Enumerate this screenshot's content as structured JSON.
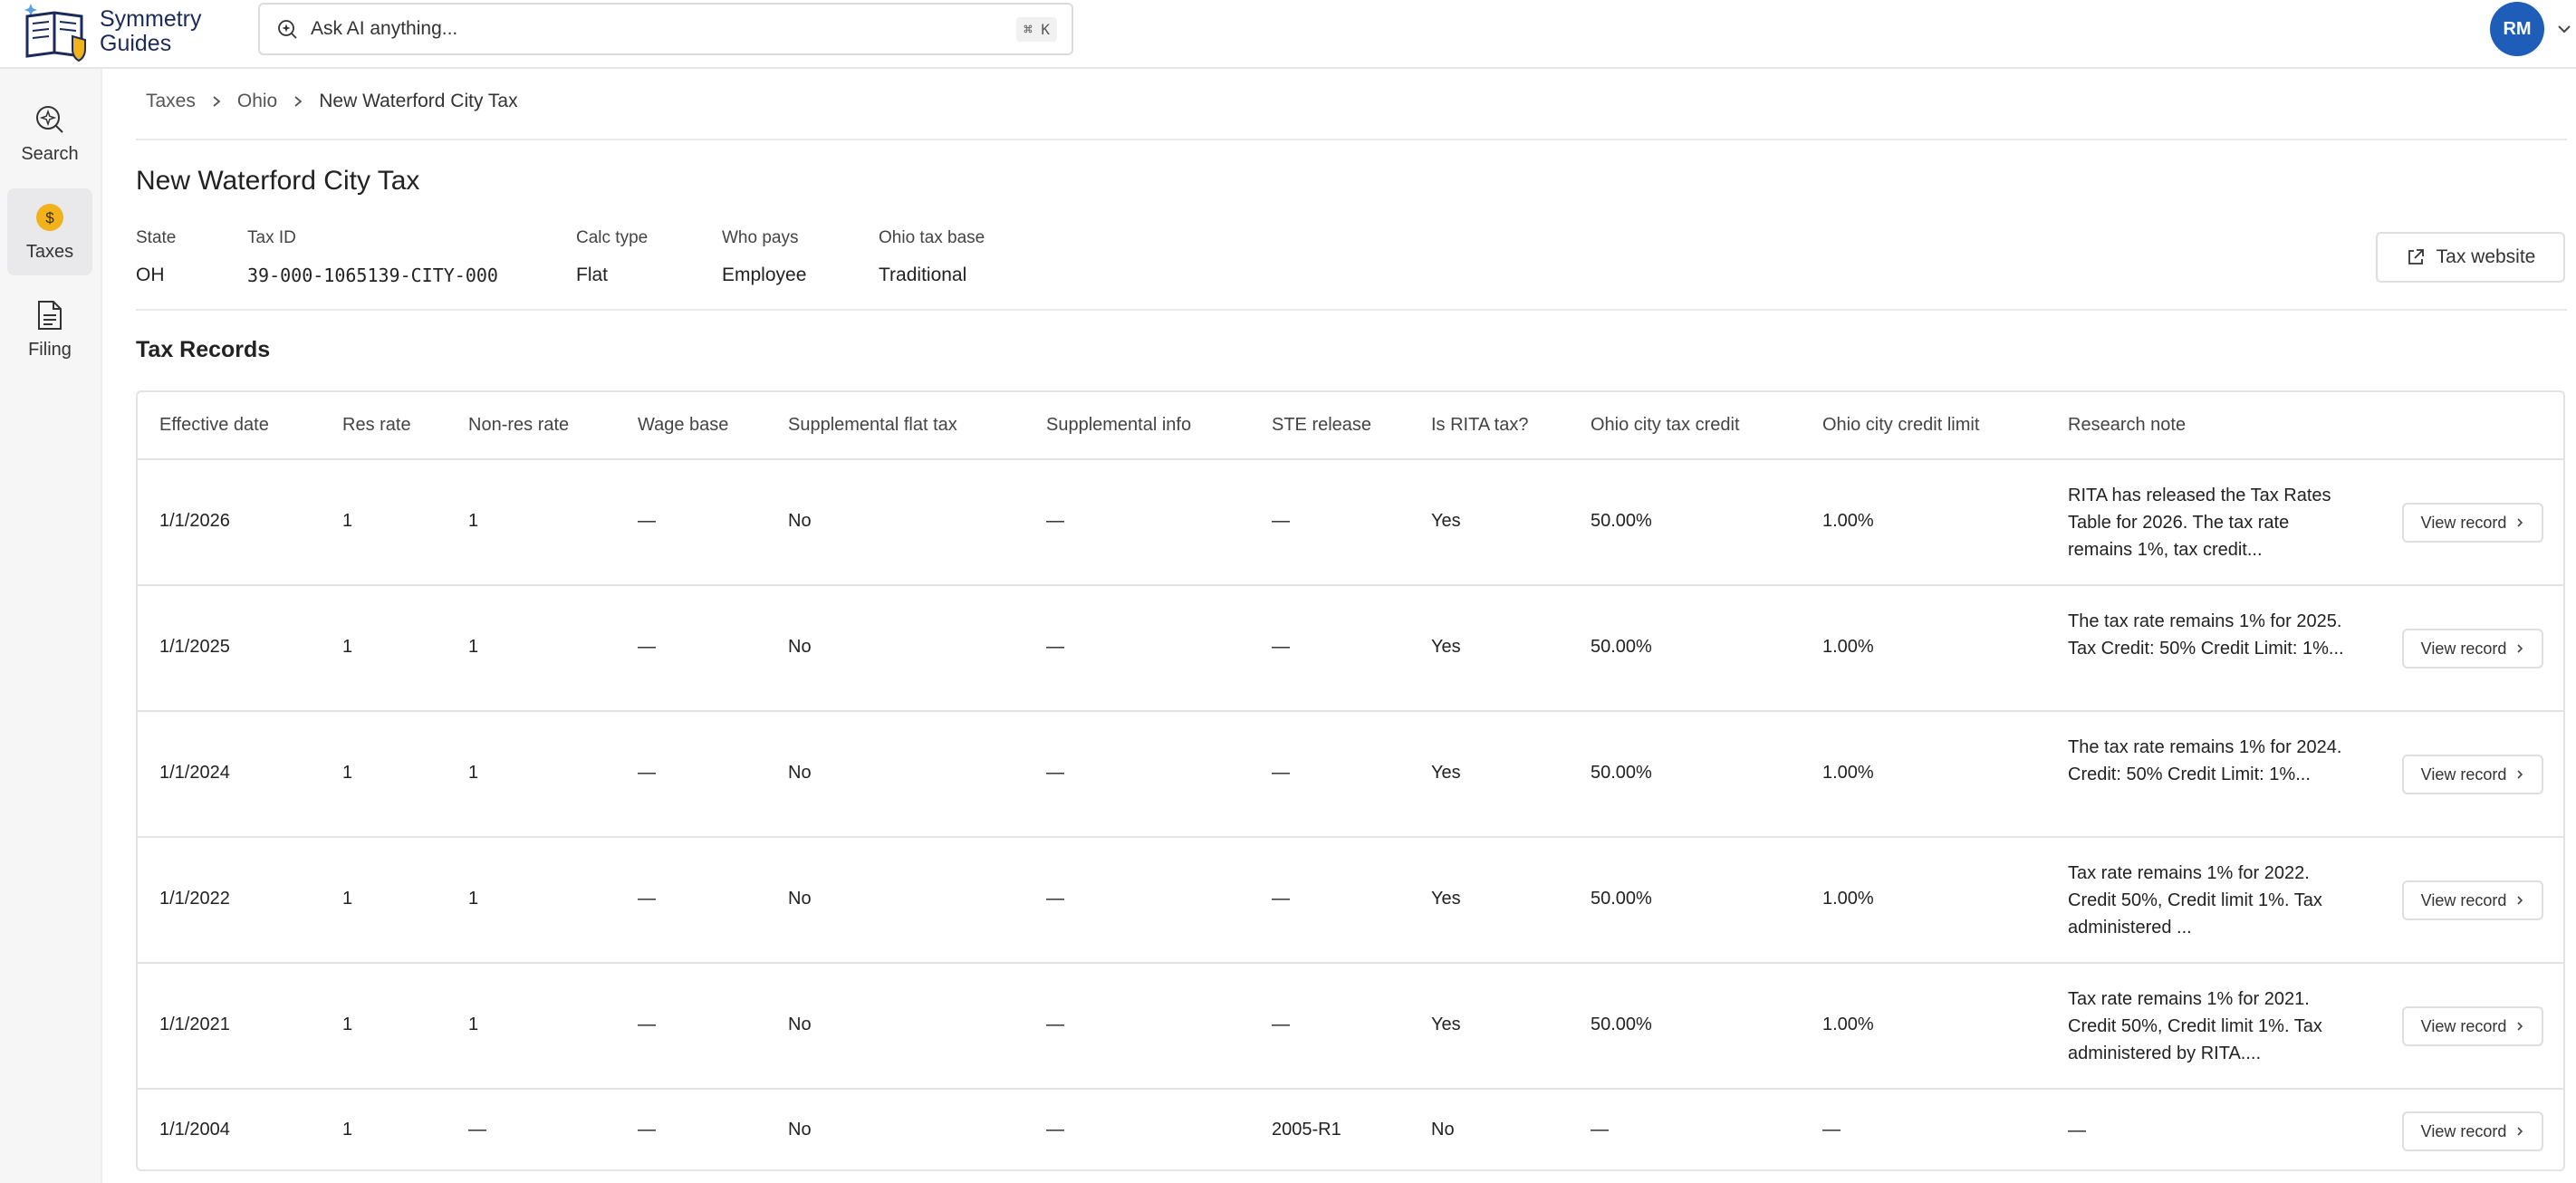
{
  "app": {
    "brand_line1": "Symmetry",
    "brand_line2": "Guides"
  },
  "search": {
    "placeholder": "Ask AI anything...",
    "shortcut": "⌘ K"
  },
  "user": {
    "initials": "RM"
  },
  "sidebar": {
    "items": [
      {
        "label": "Search",
        "icon": "search-sparkle-icon"
      },
      {
        "label": "Taxes",
        "icon": "dollar-coin-icon",
        "active": true
      },
      {
        "label": "Filing",
        "icon": "document-icon"
      }
    ]
  },
  "breadcrumb": [
    "Taxes",
    "Ohio",
    "New Waterford City Tax"
  ],
  "page": {
    "title": "New Waterford City Tax",
    "tax_website_label": "Tax website"
  },
  "meta": [
    {
      "label": "State",
      "value": "OH"
    },
    {
      "label": "Tax ID",
      "value": "39-000-1065139-CITY-000"
    },
    {
      "label": "Calc type",
      "value": "Flat"
    },
    {
      "label": "Who pays",
      "value": "Employee"
    },
    {
      "label": "Ohio tax base",
      "value": "Traditional"
    }
  ],
  "records": {
    "title": "Tax Records",
    "columns": [
      "Effective date",
      "Res rate",
      "Non-res rate",
      "Wage base",
      "Supplemental flat tax",
      "Supplemental info",
      "STE release",
      "Is RITA tax?",
      "Ohio city tax credit",
      "Ohio city credit limit",
      "Research note"
    ],
    "view_label": "View record",
    "rows": [
      {
        "date": "1/1/2026",
        "res": "1",
        "nonres": "1",
        "wage": "—",
        "supp_flat": "No",
        "supp_info": "—",
        "ste": "—",
        "rita": "Yes",
        "credit": "50.00%",
        "limit": "1.00%",
        "note": "RITA has released the Tax Rates Table for 2026. The tax rate remains 1%, tax credit..."
      },
      {
        "date": "1/1/2025",
        "res": "1",
        "nonres": "1",
        "wage": "—",
        "supp_flat": "No",
        "supp_info": "—",
        "ste": "—",
        "rita": "Yes",
        "credit": "50.00%",
        "limit": "1.00%",
        "note": "The tax rate remains 1% for 2025. Tax Credit: 50% Credit Limit: 1%..."
      },
      {
        "date": "1/1/2024",
        "res": "1",
        "nonres": "1",
        "wage": "—",
        "supp_flat": "No",
        "supp_info": "—",
        "ste": "—",
        "rita": "Yes",
        "credit": "50.00%",
        "limit": "1.00%",
        "note": "The tax rate remains 1% for 2024. Credit: 50% Credit Limit: 1%..."
      },
      {
        "date": "1/1/2022",
        "res": "1",
        "nonres": "1",
        "wage": "—",
        "supp_flat": "No",
        "supp_info": "—",
        "ste": "—",
        "rita": "Yes",
        "credit": "50.00%",
        "limit": "1.00%",
        "note": "Tax rate remains 1% for 2022. Credit 50%, Credit limit 1%. Tax administered ..."
      },
      {
        "date": "1/1/2021",
        "res": "1",
        "nonres": "1",
        "wage": "—",
        "supp_flat": "No",
        "supp_info": "—",
        "ste": "—",
        "rita": "Yes",
        "credit": "50.00%",
        "limit": "1.00%",
        "note": "Tax rate remains 1% for 2021. Credit 50%, Credit limit 1%. Tax administered by RITA...."
      },
      {
        "date": "1/1/2004",
        "res": "1",
        "nonres": "—",
        "wage": "—",
        "supp_flat": "No",
        "supp_info": "—",
        "ste": "2005-R1",
        "rita": "No",
        "credit": "—",
        "limit": "—",
        "note": "—"
      }
    ]
  },
  "colors": {
    "avatar": "#1f5eb8",
    "coin": "#f2b21b",
    "logo_navy": "#1b2a5a"
  }
}
